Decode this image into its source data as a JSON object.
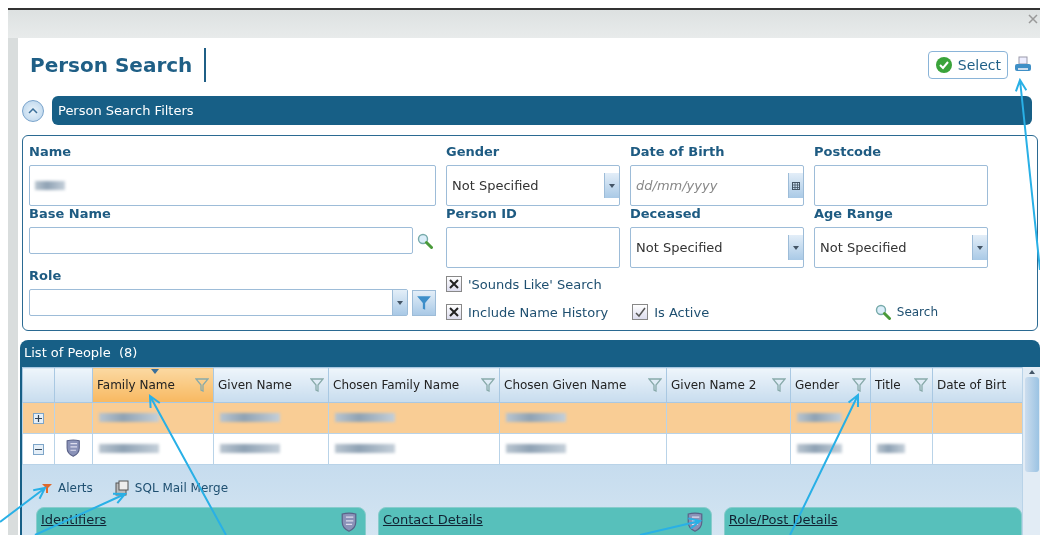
{
  "page_title": "Person Search",
  "select_button": "Select",
  "filters_section": {
    "title": "Person Search Filters",
    "expanded": true
  },
  "fields": [
    {
      "label": "Name",
      "kind": "text",
      "redacted": true
    },
    {
      "label": "Gender",
      "kind": "select",
      "value": "Not Specified"
    },
    {
      "label": "Date of Birth",
      "kind": "date",
      "placeholder": "dd/mm/yyyy"
    },
    {
      "label": "Postcode",
      "kind": "text",
      "redacted": false
    },
    {
      "label": "Base Name",
      "kind": "lookup"
    },
    {
      "label": "Person ID",
      "kind": "text",
      "redacted": false
    },
    {
      "label": "Deceased",
      "kind": "select",
      "value": "Not Specified"
    },
    {
      "label": "Age Range",
      "kind": "select",
      "value": "Not Specified"
    },
    {
      "label": "Role",
      "kind": "select_filter"
    }
  ],
  "option_rows": [
    [
      {
        "label": "'Sounds Like' Search",
        "checked": true,
        "kind": "cross"
      }
    ],
    [
      {
        "label": "Include Name History",
        "checked": true,
        "kind": "cross"
      },
      {
        "label": "Is Active",
        "checked": true,
        "kind": "tick"
      }
    ]
  ],
  "search_link": "Search",
  "list": {
    "title": "List of People",
    "count": "(8)",
    "columns": [
      {
        "label": "Family Name",
        "sorted": true,
        "filter": true
      },
      {
        "label": "Given Name",
        "sorted": false,
        "filter": true
      },
      {
        "label": "Chosen Family Name",
        "sorted": false,
        "filter": true
      },
      {
        "label": "Chosen Given Name",
        "sorted": false,
        "filter": true
      },
      {
        "label": "Given Name 2",
        "sorted": false,
        "filter": true
      },
      {
        "label": "Gender",
        "sorted": false,
        "filter": true
      },
      {
        "label": "Title",
        "sorted": false,
        "filter": true
      },
      {
        "label": "Date of Birt",
        "sorted": false,
        "filter": false
      }
    ],
    "rows": [
      {
        "selected": true,
        "expanded": false,
        "shield": false,
        "cells": [
          {
            "redacted": true
          },
          {
            "redacted": true
          },
          {
            "redacted": true
          },
          {
            "redacted": true
          },
          {
            "redacted": false
          },
          {
            "redacted": true
          },
          {
            "redacted": false
          },
          {
            "redacted": false
          }
        ]
      },
      {
        "selected": false,
        "expanded": true,
        "shield": true,
        "cells": [
          {
            "redacted": true
          },
          {
            "redacted": true
          },
          {
            "redacted": true
          },
          {
            "redacted": true
          },
          {
            "redacted": false
          },
          {
            "redacted": true
          },
          {
            "redacted": true
          },
          {
            "redacted": false
          }
        ]
      }
    ]
  },
  "detail": {
    "actions": [
      {
        "label": "Alerts",
        "kind": "alerts"
      },
      {
        "label": "SQL Mail Merge",
        "kind": "mail_merge"
      }
    ],
    "cards": [
      {
        "title": "Identifiers",
        "shield": true
      },
      {
        "title": "Contact Details",
        "shield": true
      },
      {
        "title": "Role/Post Details",
        "shield": false
      }
    ]
  }
}
